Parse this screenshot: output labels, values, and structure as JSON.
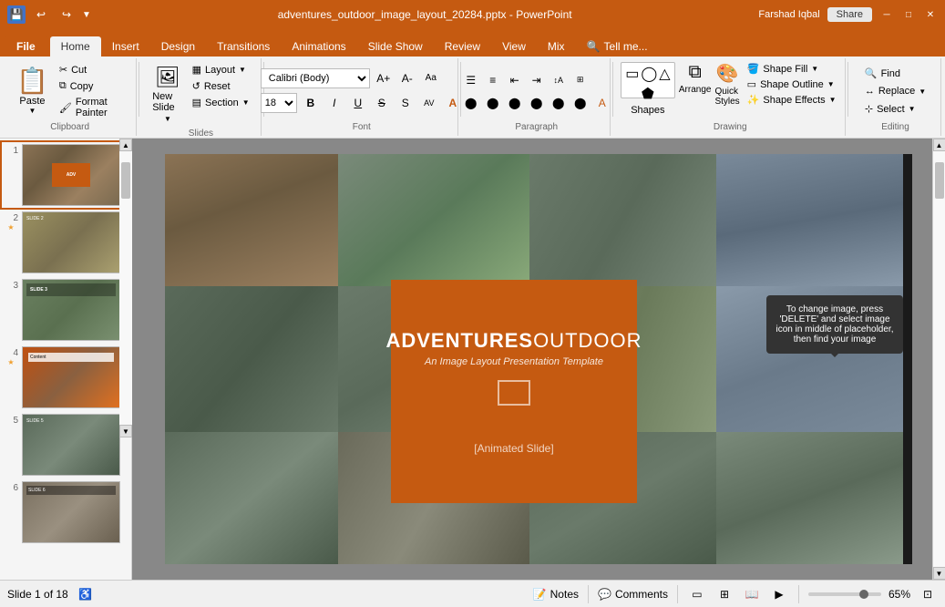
{
  "titlebar": {
    "filename": "adventures_outdoor_image_layout_20284.pptx - PowerPoint",
    "user": "Farshad Iqbal",
    "share_label": "Share"
  },
  "ribbon": {
    "tabs": [
      "File",
      "Home",
      "Insert",
      "Design",
      "Transitions",
      "Animations",
      "Slide Show",
      "Review",
      "View",
      "Mix"
    ],
    "active_tab": "Home",
    "tell_me": "Tell me...",
    "groups": {
      "clipboard": {
        "label": "Clipboard",
        "paste": "Paste",
        "cut": "Cut",
        "copy": "Copy",
        "format_painter": "Format Painter"
      },
      "slides": {
        "label": "Slides",
        "new_slide": "New Slide",
        "layout": "Layout",
        "reset": "Reset",
        "section": "Section"
      },
      "font": {
        "label": "Font",
        "font_name": "Calibri (Body)",
        "font_size": "18",
        "bold": "B",
        "italic": "I",
        "underline": "U",
        "strikethrough": "S",
        "shadow": "S"
      },
      "paragraph": {
        "label": "Paragraph"
      },
      "drawing": {
        "label": "Drawing",
        "shapes": "Shapes",
        "arrange": "Arrange",
        "quick_styles": "Quick Styles",
        "shape_fill": "Shape Fill",
        "shape_outline": "Shape Outline",
        "shape_effects": "Shape Effects"
      },
      "editing": {
        "label": "Editing",
        "find": "Find",
        "replace": "Replace",
        "select": "Select"
      }
    }
  },
  "slide_panel": {
    "slides": [
      {
        "num": "1",
        "starred": false,
        "active": true
      },
      {
        "num": "2",
        "starred": true
      },
      {
        "num": "3",
        "starred": false
      },
      {
        "num": "4",
        "starred": true
      },
      {
        "num": "5",
        "starred": false
      },
      {
        "num": "6",
        "starred": false
      }
    ]
  },
  "canvas": {
    "title": "ADVENTURES",
    "title_bold": "OUTDOOR",
    "subtitle": "An Image Layout Presentation Template",
    "animated_label": "[Animated Slide]",
    "tooltip": "To change image, press 'DELETE' and select image icon in middle of placeholder, then find your image"
  },
  "statusbar": {
    "slide_info": "Slide 1 of 18",
    "notes_label": "Notes",
    "comments_label": "Comments",
    "zoom": "65%"
  }
}
